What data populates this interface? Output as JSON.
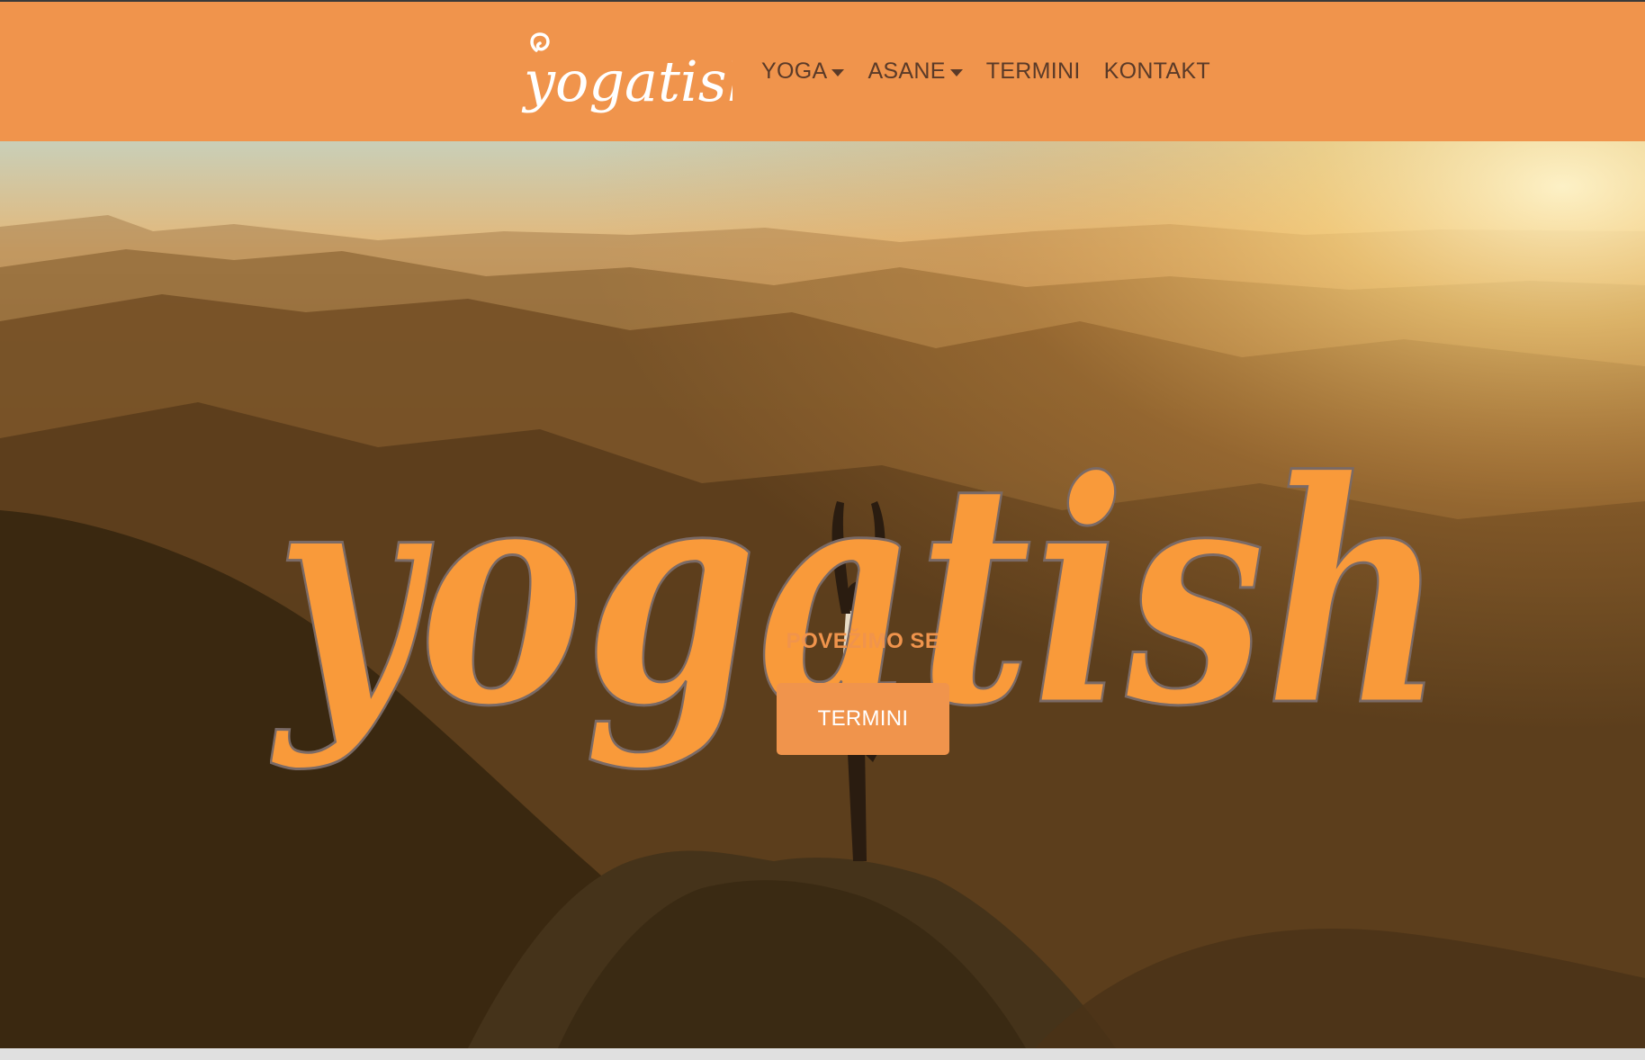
{
  "navbar": {
    "brand": "yogatish",
    "items": [
      {
        "label": "YOGA",
        "dropdown": true
      },
      {
        "label": "ASANE",
        "dropdown": true
      },
      {
        "label": "TERMINI",
        "dropdown": false
      },
      {
        "label": "KONTAKT",
        "dropdown": false
      }
    ]
  },
  "hero": {
    "logo_text": "yogatish",
    "tagline": "POVEŽIMO SE",
    "button_label": "TERMINI"
  },
  "colors": {
    "accent": "#f0944c",
    "nav_text": "#5a3a28",
    "logo_fill": "#f99a3a",
    "logo_outline": "#7a6a66"
  }
}
